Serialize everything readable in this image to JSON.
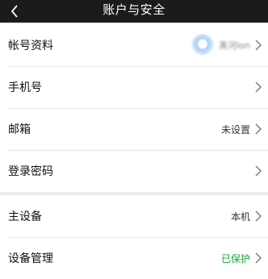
{
  "header": {
    "title": "账户与安全"
  },
  "account_group": [
    {
      "label": "帐号资料",
      "value": "黑河lon"
    },
    {
      "label": "手机号",
      "value": ""
    },
    {
      "label": "邮箱",
      "value": "未设置"
    },
    {
      "label": "登录密码",
      "value": ""
    }
  ],
  "device_group": [
    {
      "label": "主设备",
      "value": "本机"
    },
    {
      "label": "设备管理",
      "value": "已保护",
      "value_color": "#19a83a"
    }
  ],
  "icons": {
    "back": "chevron-left-icon",
    "row_arrow": "chevron-right-icon",
    "avatar": "avatar"
  },
  "colors": {
    "header_bg": "#1b1b1b",
    "page_bg": "#ededed",
    "protected_green": "#19a83a"
  }
}
